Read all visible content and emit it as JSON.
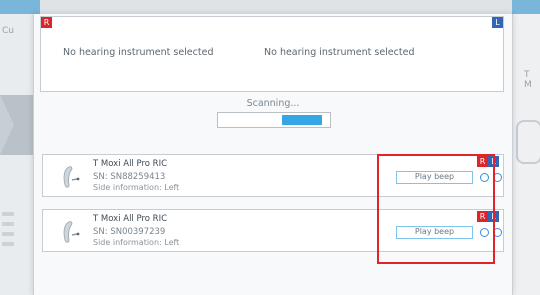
{
  "background": {
    "left_label": "Cu",
    "right_label": "T M"
  },
  "dialog": {
    "selection": {
      "badge_right": "R",
      "badge_left": "L",
      "right_status": "No hearing instrument selected",
      "left_status": "No hearing instrument selected"
    },
    "scan": {
      "label": "Scanning...",
      "progress_start": 0.57,
      "progress_end": 0.93
    },
    "devices": [
      {
        "name": "T Moxi All Pro RIC",
        "serial": "SN: SN88259413",
        "side": "Side information: Left",
        "play_label": "Play beep",
        "badge_right": "R",
        "badge_left": "L"
      },
      {
        "name": "T Moxi All Pro RIC",
        "serial": "SN: SN00397239",
        "side": "Side information: Left",
        "play_label": "Play beep",
        "badge_right": "R",
        "badge_left": "L"
      }
    ]
  },
  "colors": {
    "badge_red": "#d9262b",
    "badge_blue": "#3264b8",
    "progress_blue": "#35a6e5",
    "highlight": "#e3232a"
  }
}
